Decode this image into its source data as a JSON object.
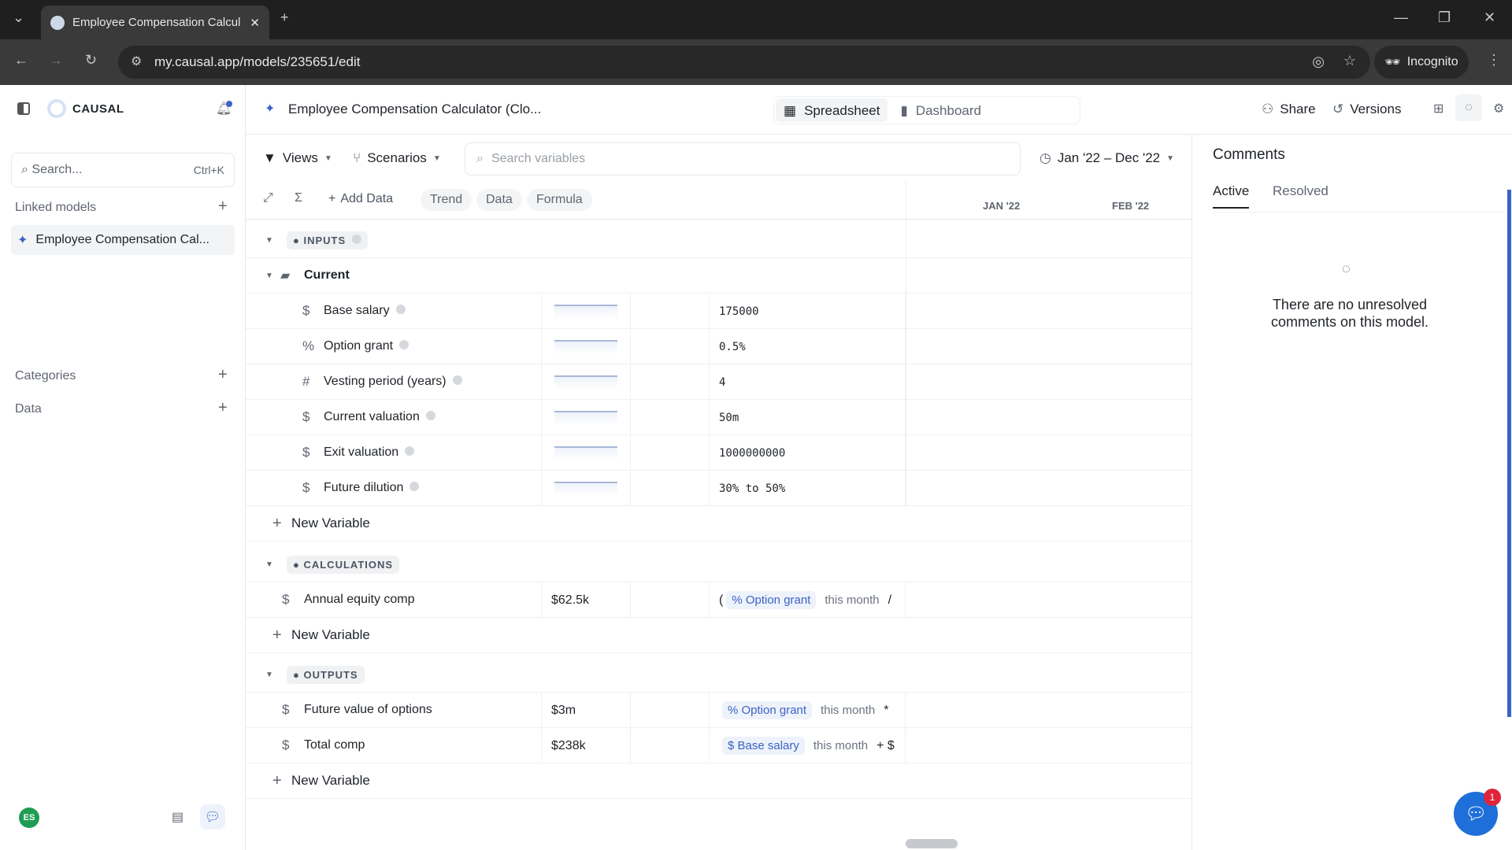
{
  "browser": {
    "tab_title": "Employee Compensation Calcul",
    "url": "my.causal.app/models/235651/edit",
    "incognito": "Incognito"
  },
  "sidebar": {
    "brand": "CAUSAL",
    "search_placeholder": "Search...",
    "search_shortcut": "Ctrl+K",
    "linked_models": "Linked models",
    "linked_item": "Employee Compensation Cal...",
    "categories": "Categories",
    "data": "Data",
    "avatar": "ES"
  },
  "header": {
    "title": "Employee Compensation Calculator (Clo...",
    "spreadsheet": "Spreadsheet",
    "dashboard": "Dashboard",
    "share": "Share",
    "versions": "Versions"
  },
  "toolbar": {
    "views": "Views",
    "scenarios": "Scenarios",
    "search_placeholder": "Search variables",
    "date_range": "Jan '22 – Dec '22",
    "add_data": "Add Data",
    "trend": "Trend",
    "data": "Data",
    "formula": "Formula",
    "months": [
      "JAN '22",
      "FEB '22"
    ]
  },
  "sections": {
    "inputs": {
      "label": "INPUTS",
      "folder": "Current",
      "rows": [
        {
          "icon": "$",
          "name": "Base salary",
          "value": "175000"
        },
        {
          "icon": "%",
          "name": "Option grant",
          "value": "0.5%"
        },
        {
          "icon": "#",
          "name": "Vesting period (years)",
          "value": "4"
        },
        {
          "icon": "$",
          "name": "Current valuation",
          "value": "50m"
        },
        {
          "icon": "$",
          "name": "Exit valuation",
          "value": "1000000000"
        },
        {
          "icon": "$",
          "name": "Future dilution",
          "value": "30% to 50%"
        }
      ]
    },
    "calculations": {
      "label": "CALCULATIONS",
      "rows": [
        {
          "icon": "$",
          "name": "Annual equity comp",
          "value": "$62.5k",
          "formula_pre": "(",
          "token": "% Option grant",
          "time": "this month",
          "formula_post": "/"
        }
      ]
    },
    "outputs": {
      "label": "OUTPUTS",
      "rows": [
        {
          "icon": "$",
          "name": "Future value of options",
          "value": "$3m",
          "formula_pre": "",
          "token": "% Option grant",
          "time": "this month",
          "formula_post": "*"
        },
        {
          "icon": "$",
          "name": "Total comp",
          "value": "$238k",
          "formula_pre": "",
          "token": "$ Base salary",
          "time": "this month",
          "formula_post": "+ $"
        }
      ]
    },
    "new_variable": "New Variable"
  },
  "comments": {
    "title": "Comments",
    "tab_active": "Active",
    "tab_resolved": "Resolved",
    "empty": "There are no unresolved comments on this model."
  },
  "chat_badge": "1",
  "colors": {
    "accent": "#3b63c4",
    "chat": "#1e6fd9"
  }
}
